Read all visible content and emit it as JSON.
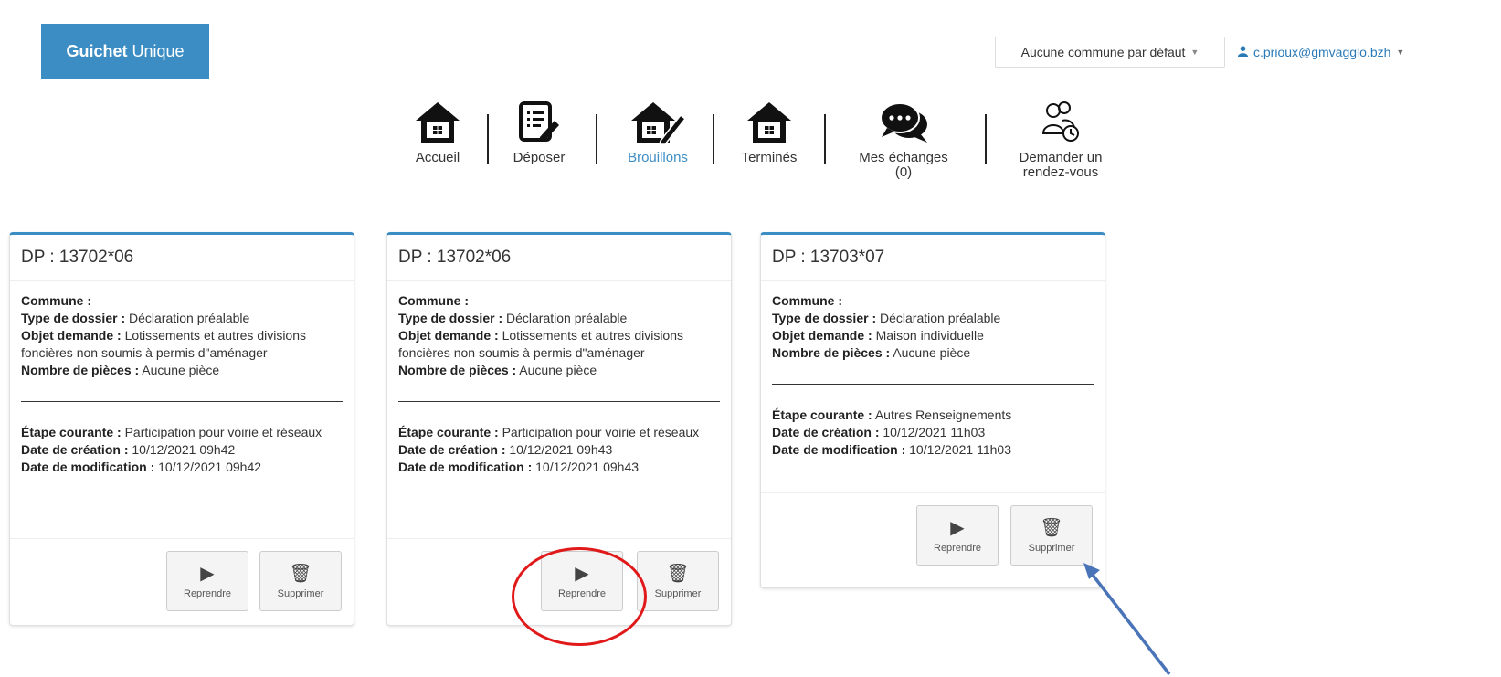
{
  "header": {
    "brand_bold": "Guichet",
    "brand_rest": "Unique",
    "commune_select": "Aucune commune par défaut",
    "user_email": "c.prioux@gmvagglo.bzh"
  },
  "nav": {
    "items": [
      {
        "label": "Accueil",
        "icon": "home-icon"
      },
      {
        "label": "Déposer",
        "icon": "document-edit-icon"
      },
      {
        "label": "Brouillons",
        "icon": "house-pencil-icon",
        "active": true
      },
      {
        "label": "Terminés",
        "icon": "home-icon"
      },
      {
        "label": "Mes échanges",
        "sub": "(0)",
        "icon": "chat-bubbles-icon"
      },
      {
        "label": "Demander un",
        "sub": "rendez-vous",
        "icon": "people-clock-icon"
      }
    ]
  },
  "cards": [
    {
      "title": "DP : 13702*06",
      "commune_label": "Commune :",
      "type_label": "Type de dossier :",
      "type_value": "Déclaration préalable",
      "objet_label": "Objet demande :",
      "objet_value": "Lotissements et autres divisions foncières non soumis à permis d\"aménager",
      "pieces_label": "Nombre de pièces :",
      "pieces_value": "Aucune pièce",
      "etape_label": "Étape courante :",
      "etape_value": "Participation pour voirie et réseaux",
      "creation_label": "Date de création :",
      "creation_value": "10/12/2021 09h42",
      "modif_label": "Date de modification :",
      "modif_value": "10/12/2021 09h42",
      "resume_label": "Reprendre",
      "delete_label": "Supprimer"
    },
    {
      "title": "DP : 13702*06",
      "commune_label": "Commune :",
      "type_label": "Type de dossier :",
      "type_value": "Déclaration préalable",
      "objet_label": "Objet demande :",
      "objet_value": "Lotissements et autres divisions foncières non soumis à permis d\"aménager",
      "pieces_label": "Nombre de pièces :",
      "pieces_value": "Aucune pièce",
      "etape_label": "Étape courante :",
      "etape_value": "Participation pour voirie et réseaux",
      "creation_label": "Date de création :",
      "creation_value": "10/12/2021 09h43",
      "modif_label": "Date de modification :",
      "modif_value": "10/12/2021 09h43",
      "resume_label": "Reprendre",
      "delete_label": "Supprimer"
    },
    {
      "title": "DP : 13703*07",
      "commune_label": "Commune :",
      "type_label": "Type de dossier :",
      "type_value": "Déclaration préalable",
      "objet_label": "Objet demande :",
      "objet_value": "Maison individuelle",
      "pieces_label": "Nombre de pièces :",
      "pieces_value": "Aucune pièce",
      "etape_label": "Étape courante :",
      "etape_value": "Autres Renseignements",
      "creation_label": "Date de création :",
      "creation_value": "10/12/2021 11h03",
      "modif_label": "Date de modification :",
      "modif_value": "10/12/2021 11h03",
      "resume_label": "Reprendre",
      "delete_label": "Supprimer"
    }
  ],
  "colors": {
    "accent": "#3c8dc4",
    "annotation_red": "#e01a1a",
    "annotation_arrow": "#4a74b8"
  }
}
